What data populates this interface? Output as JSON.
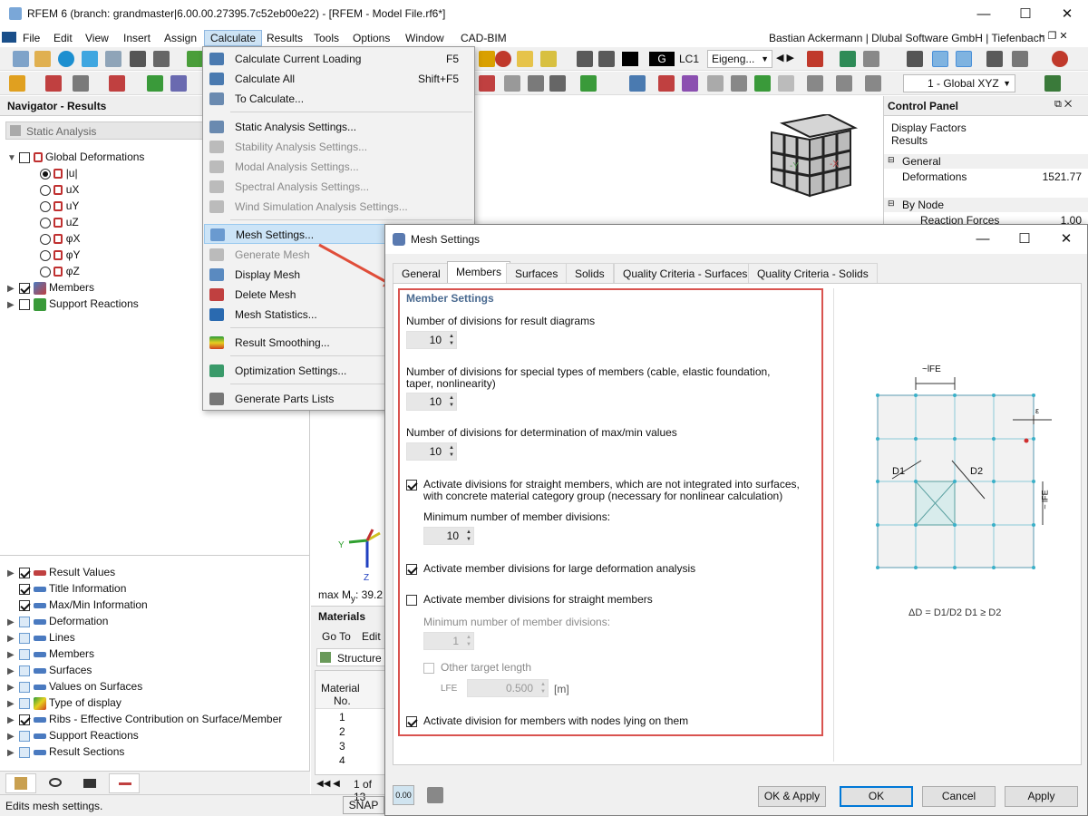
{
  "window": {
    "title": "RFEM 6 (branch: grandmaster|6.00.00.27395.7c52eb00e22) - [RFEM - Model File.rf6*]",
    "user": "Bastian Ackermann | Dlubal Software GmbH | Tiefenbach"
  },
  "menu": [
    "File",
    "Edit",
    "View",
    "Insert",
    "Assign",
    "Calculate",
    "Results",
    "Tools",
    "Options",
    "Window",
    "CAD-BIM"
  ],
  "toolbar": {
    "load_case_badge": "G",
    "load_case": "LC1",
    "load_case_name": "Eigeng...",
    "coord_system": "1 - Global XYZ"
  },
  "calculate_menu": [
    {
      "label": "Calculate Current Loading",
      "shortcut": "F5",
      "enabled": true
    },
    {
      "label": "Calculate All",
      "shortcut": "Shift+F5",
      "enabled": true
    },
    {
      "label": "To Calculate...",
      "shortcut": "",
      "enabled": true
    },
    {
      "label": "Static Analysis Settings...",
      "shortcut": "",
      "enabled": true
    },
    {
      "label": "Stability Analysis Settings...",
      "shortcut": "",
      "enabled": false
    },
    {
      "label": "Modal Analysis Settings...",
      "shortcut": "",
      "enabled": false
    },
    {
      "label": "Spectral Analysis Settings...",
      "shortcut": "",
      "enabled": false
    },
    {
      "label": "Wind Simulation Analysis Settings...",
      "shortcut": "",
      "enabled": false
    },
    {
      "label": "Mesh Settings...",
      "shortcut": "",
      "enabled": true
    },
    {
      "label": "Generate Mesh",
      "shortcut": "",
      "enabled": false
    },
    {
      "label": "Display Mesh",
      "shortcut": "",
      "enabled": true
    },
    {
      "label": "Delete Mesh",
      "shortcut": "",
      "enabled": true
    },
    {
      "label": "Mesh Statistics...",
      "shortcut": "",
      "enabled": true
    },
    {
      "label": "Result Smoothing...",
      "shortcut": "",
      "enabled": true
    },
    {
      "label": "Optimization Settings...",
      "shortcut": "",
      "enabled": true
    },
    {
      "label": "Generate Parts Lists",
      "shortcut": "",
      "enabled": true
    }
  ],
  "navigator": {
    "title": "Navigator - Results",
    "analysis": "Static Analysis",
    "tree": [
      {
        "label": "Global Deformations",
        "checked": false,
        "level": 0
      },
      {
        "label": "|u|",
        "radio": true,
        "on": true,
        "level": 1
      },
      {
        "label": "uX",
        "radio": true,
        "on": false,
        "level": 1
      },
      {
        "label": "uY",
        "radio": true,
        "on": false,
        "level": 1
      },
      {
        "label": "uZ",
        "radio": true,
        "on": false,
        "level": 1
      },
      {
        "label": "φX",
        "radio": true,
        "on": false,
        "level": 1
      },
      {
        "label": "φY",
        "radio": true,
        "on": false,
        "level": 1
      },
      {
        "label": "φZ",
        "radio": true,
        "on": false,
        "level": 1
      },
      {
        "label": "Members",
        "checked": true,
        "level": 0
      },
      {
        "label": "Support Reactions",
        "checked": false,
        "level": 0
      }
    ],
    "lower": [
      {
        "label": "Result Values",
        "checked": true
      },
      {
        "label": "Title Information",
        "checked": true
      },
      {
        "label": "Max/Min Information",
        "checked": true
      },
      {
        "label": "Deformation",
        "checked": false
      },
      {
        "label": "Lines",
        "checked": false
      },
      {
        "label": "Members",
        "checked": false
      },
      {
        "label": "Surfaces",
        "checked": false
      },
      {
        "label": "Values on Surfaces",
        "checked": false
      },
      {
        "label": "Type of display",
        "checked": false
      },
      {
        "label": "Ribs - Effective Contribution on Surface/Member",
        "checked": true
      },
      {
        "label": "Support Reactions",
        "checked": false
      },
      {
        "label": "Result Sections",
        "checked": false
      }
    ]
  },
  "status": "Edits mesh settings.",
  "viewport": {
    "max_label": "max M",
    "max_sub": "y",
    "max_value": ": 39.2",
    "axis_y": "Y",
    "axis_z": "Z"
  },
  "materials": {
    "title": "Materials",
    "goto": "Go To",
    "edit": "Edit",
    "structure": "Structure",
    "col1": "Material",
    "col2": "No.",
    "rows": [
      "1",
      "2",
      "3",
      "4"
    ],
    "pager": "1 of 13",
    "snap": "SNAP"
  },
  "control_panel": {
    "title": "Control Panel",
    "sub1": "Display Factors",
    "sub2": "Results",
    "general": "General",
    "deformations": "Deformations",
    "deformations_val": "1521.77",
    "by_node": "By Node",
    "reaction": "Reaction Forces",
    "reaction_val": "1.00"
  },
  "dialog": {
    "title": "Mesh Settings",
    "tabs": [
      "General",
      "Members",
      "Surfaces",
      "Solids",
      "Quality Criteria - Surfaces",
      "Quality Criteria - Solids"
    ],
    "section": "Member Settings",
    "l1": "Number of divisions for result diagrams",
    "v1": "10",
    "l2a": "Number of divisions for special types of members (cable, elastic foundation,",
    "l2b": "taper, nonlinearity)",
    "v2": "10",
    "l3": "Number of divisions for determination of max/min values",
    "v3": "10",
    "c1a": "Activate divisions for straight members, which are not integrated into surfaces,",
    "c1b": "with concrete material category group (necessary for nonlinear calculation)",
    "min_div": "Minimum number of member divisions:",
    "v4": "10",
    "c2": "Activate member divisions for large deformation analysis",
    "c3": "Activate member divisions for straight members",
    "min_div2": "Minimum number of member divisions:",
    "v5": "1",
    "c4": "Other target length",
    "lfe": "LFE",
    "v6": "0.500",
    "unit": "[m]",
    "c5": "Activate division for members with nodes lying on them",
    "btn_ok_apply": "OK & Apply",
    "btn_ok": "OK",
    "btn_cancel": "Cancel",
    "btn_apply": "Apply",
    "fig_lfe": "~lFE",
    "fig_eps": "ε",
    "fig_d1": "D1",
    "fig_d2": "D2",
    "fig_lfe2": "~ lFE",
    "fig_formula": "ΔD = D1/D2     D1 ≥ D2"
  }
}
